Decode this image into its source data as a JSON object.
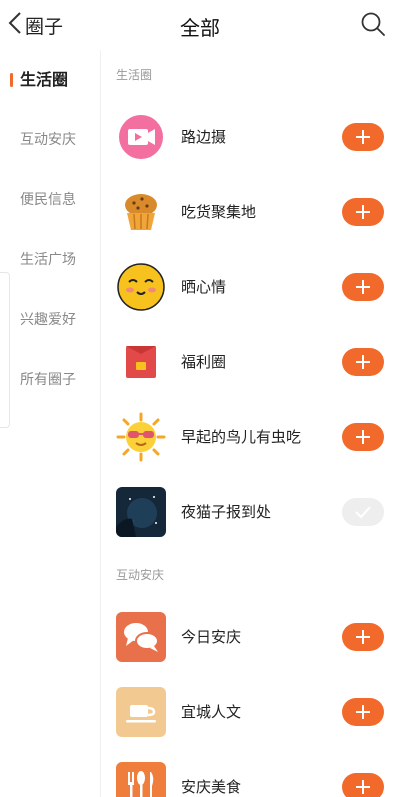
{
  "header": {
    "back_label": "圈子",
    "title": "全部",
    "icons": {
      "back": "chevron-left-icon",
      "search": "search-icon"
    }
  },
  "sidebar": {
    "items": [
      {
        "label": "生活圈",
        "active": true
      },
      {
        "label": "互动安庆",
        "active": false
      },
      {
        "label": "便民信息",
        "active": false
      },
      {
        "label": "生活广场",
        "active": false
      },
      {
        "label": "兴趣爱好",
        "active": false
      },
      {
        "label": "所有圈子",
        "active": false
      }
    ]
  },
  "sections": [
    {
      "title": "生活圈",
      "items": [
        {
          "name": "路边摄",
          "icon": "video-camera-icon",
          "joined": false
        },
        {
          "name": "吃货聚集地",
          "icon": "muffin-icon",
          "joined": false
        },
        {
          "name": "晒心情",
          "icon": "smiley-face-icon",
          "joined": false
        },
        {
          "name": "福利圈",
          "icon": "red-envelope-icon",
          "joined": false
        },
        {
          "name": "早起的鸟儿有虫吃",
          "icon": "sun-sunglasses-icon",
          "joined": false
        },
        {
          "name": "夜猫子报到处",
          "icon": "night-moon-icon",
          "joined": true
        }
      ]
    },
    {
      "title": "互动安庆",
      "items": [
        {
          "name": "今日安庆",
          "icon": "chat-bubbles-icon",
          "joined": false
        },
        {
          "name": "宜城人文",
          "icon": "teacup-icon",
          "joined": false
        },
        {
          "name": "安庆美食",
          "icon": "cutlery-icon",
          "joined": false
        }
      ]
    }
  ],
  "colors": {
    "accent": "#f26a2b",
    "joined_bg": "#eeeeee"
  }
}
